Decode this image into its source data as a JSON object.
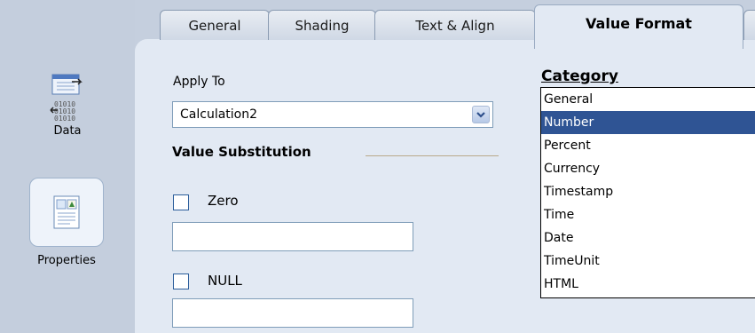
{
  "tabs": [
    {
      "label": "General",
      "active": false
    },
    {
      "label": "Shading",
      "active": false
    },
    {
      "label": "Text & Align",
      "active": false
    },
    {
      "label": "Value Format",
      "active": true
    }
  ],
  "sidebar": {
    "data_label": "Data",
    "properties_label": "Properties"
  },
  "apply_to": {
    "label": "Apply To",
    "value": "Calculation2"
  },
  "value_substitution": {
    "title": "Value Substitution",
    "zero_label": "Zero",
    "zero_checked": false,
    "zero_value": "",
    "null_label": "NULL",
    "null_checked": false,
    "null_value": ""
  },
  "category": {
    "title": "Category",
    "items": [
      "General",
      "Number",
      "Percent",
      "Currency",
      "Timestamp",
      "Time",
      "Date",
      "TimeUnit",
      "HTML"
    ],
    "selected": "Number"
  },
  "colors": {
    "selection": "#2f5494",
    "panel": "#e2e9f3",
    "background": "#c5cfde"
  }
}
